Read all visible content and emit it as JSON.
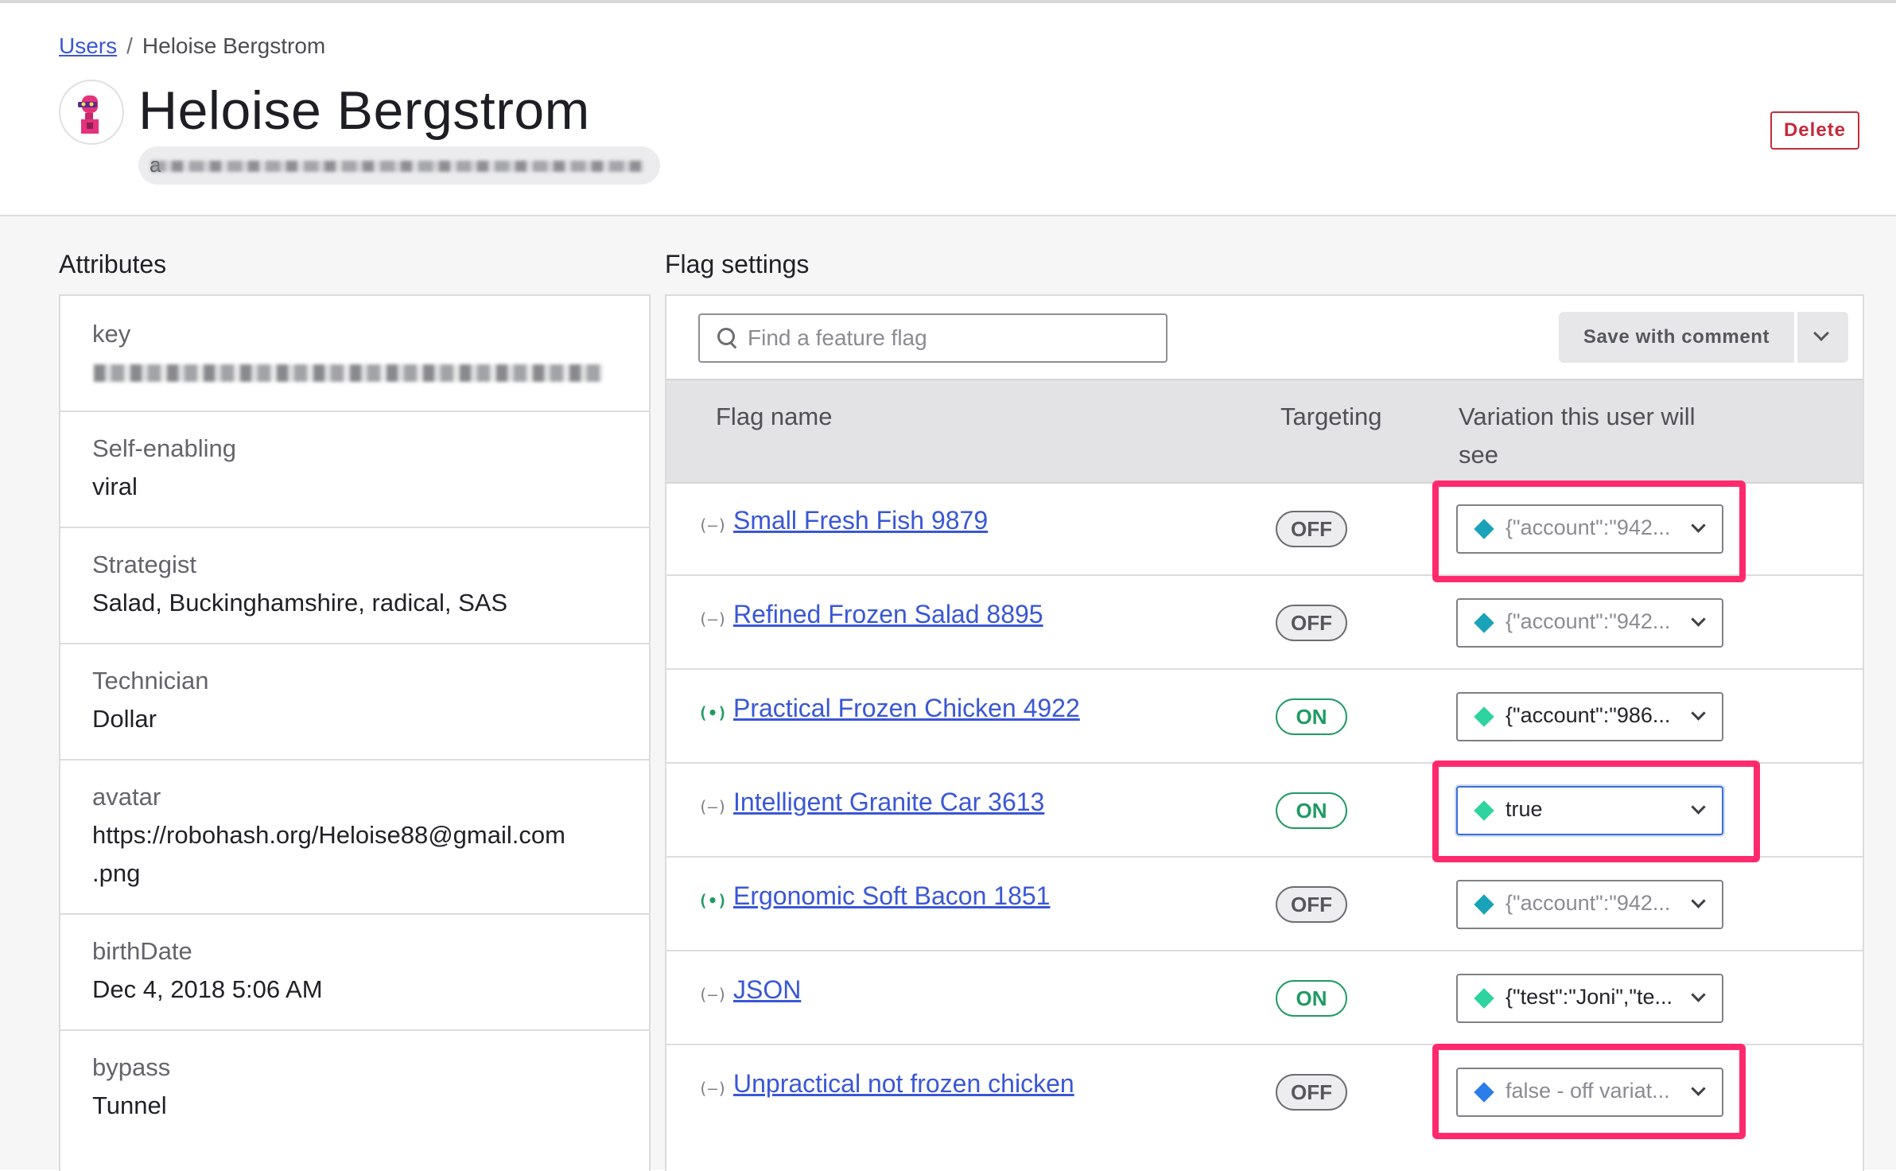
{
  "breadcrumb": {
    "parent": "Users",
    "separator": "/",
    "current": "Heloise Bergstrom"
  },
  "user": {
    "name": "Heloise Bergstrom",
    "key_prefix": "a"
  },
  "header": {
    "delete_label": "Delete"
  },
  "attributes": {
    "title": "Attributes",
    "rows": [
      {
        "label": "key",
        "value": ""
      },
      {
        "label": "Self-enabling",
        "value": "viral"
      },
      {
        "label": "Strategist",
        "value": "Salad, Buckinghamshire, radical, SAS"
      },
      {
        "label": "Technician",
        "value": "Dollar"
      },
      {
        "label": "avatar",
        "value_line1": "https://robohash.org/Heloise88@gmail.com",
        "value_line2": ".png"
      },
      {
        "label": "birthDate",
        "value": "Dec 4, 2018 5:06 AM"
      },
      {
        "label": "bypass",
        "value": "Tunnel"
      }
    ]
  },
  "flags": {
    "title": "Flag settings",
    "search_placeholder": "Find a feature flag",
    "save_label": "Save with comment",
    "columns": {
      "name": "Flag name",
      "targeting": "Targeting",
      "variation_line1": "Variation this user will",
      "variation_line2": "see"
    },
    "rows": [
      {
        "name": "Small Fresh Fish 9879",
        "status_icon": "(–)",
        "targeting": "OFF",
        "variation": "{\"account\":\"942...",
        "diamond_color": "#1aa3b8"
      },
      {
        "name": "Refined Frozen Salad 8895",
        "status_icon": "(–)",
        "targeting": "OFF",
        "variation": "{\"account\":\"942...",
        "diamond_color": "#1aa3b8"
      },
      {
        "name": "Practical Frozen Chicken 4922",
        "status_icon": "(•)",
        "targeting": "ON",
        "variation": "{\"account\":\"986...",
        "diamond_color": "#2ed3a0"
      },
      {
        "name": "Intelligent Granite Car 3613",
        "status_icon": "(–)",
        "targeting": "ON",
        "variation": "true",
        "diamond_color": "#2ed3a0"
      },
      {
        "name": "Ergonomic Soft Bacon 1851",
        "status_icon": "(•)",
        "targeting": "OFF",
        "variation": "{\"account\":\"942...",
        "diamond_color": "#1aa3b8"
      },
      {
        "name": "JSON",
        "status_icon": "(–)",
        "targeting": "ON",
        "variation": "{\"test\":\"Joni\",\"te...",
        "diamond_color": "#2ed3a0"
      },
      {
        "name": "Unpractical not frozen chicken",
        "status_icon": "(–)",
        "targeting": "OFF",
        "variation": "false - off variat...",
        "diamond_color": "#2b7de9"
      }
    ]
  },
  "colors": {
    "link": "#3a57d6",
    "danger": "#c42a3a",
    "on": "#1f9a63",
    "highlight": "#ff2a6d"
  }
}
